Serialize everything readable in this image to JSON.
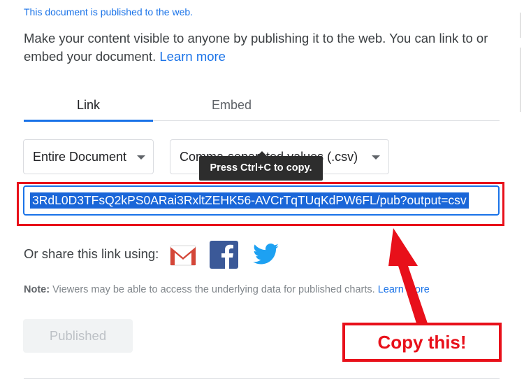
{
  "status": {
    "published_text": "This document is published to the web."
  },
  "description": {
    "text": "Make your content visible to anyone by publishing it to the web. You can link to or embed your document. ",
    "learn_more": "Learn more"
  },
  "tabs": [
    {
      "label": "Link",
      "active": true
    },
    {
      "label": "Embed",
      "active": false
    }
  ],
  "selects": {
    "scope": "Entire Document",
    "format": "Comma-separated values (.csv)"
  },
  "tooltip": {
    "text": "Press Ctrl+C to copy."
  },
  "url_field": {
    "value": "3RdL0D3TFsQ2kPS0ARai3RxltZEHK56-AVCrTqTUqKdPW6FL/pub?output=csv"
  },
  "share": {
    "label": "Or share this link using:",
    "icons": [
      "gmail-icon",
      "facebook-icon",
      "twitter-icon"
    ]
  },
  "note": {
    "label": "Note:",
    "text": " Viewers may be able to access the underlying data for published charts. ",
    "learn_more": "Learn more"
  },
  "publish_button": {
    "label": "Published"
  },
  "annotation": {
    "callout": "Copy this!"
  },
  "colors": {
    "accent": "#1a73e8",
    "annotation_red": "#e8101a",
    "tooltip_bg": "#2d2d2d",
    "facebook": "#3b5998",
    "twitter": "#1da1f2"
  }
}
